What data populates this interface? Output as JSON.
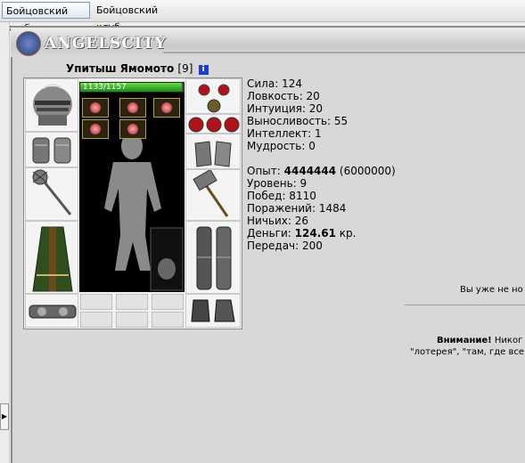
{
  "tabs": [
    {
      "label": "Бойцовский клуб",
      "active": true
    },
    {
      "label": "Бойцовский клуб",
      "active": false
    }
  ],
  "logo": {
    "text": "ANGELSCITY"
  },
  "character": {
    "name": "Упитыш Ямомото",
    "level": "[9]",
    "hp_text": "1133/1157",
    "hp_current": 1133,
    "hp_max": 1157
  },
  "stats": {
    "strength": "Сила: 124",
    "agility": "Ловкость: 20",
    "intuition": "Интуиция: 20",
    "stamina": "Выносливость: 55",
    "intellect": "Интеллект: 1",
    "wisdom": "Мудрость: 0"
  },
  "progress": {
    "exp_label": "Опыт:",
    "exp_value": "4444444",
    "exp_next": "(6000000)",
    "level": "Уровень: 9",
    "wins": "Побед: 8110",
    "losses": "Поражений: 1484",
    "draws": "Ничьих: 26",
    "money_label": "Деньги:",
    "money_value": "124.61",
    "money_unit": "кр.",
    "transfers": "Передач: 200"
  },
  "messages": {
    "line1": "Вы уже не но",
    "warning_label": "Внимание!",
    "warning_text": " Никог",
    "line3": "\"лотерея\", \"там, где все"
  },
  "icons": {
    "info": "info-icon",
    "rail_arrow": "triangle-right-icon"
  },
  "colors": {
    "hp_bar": "#2fa82f",
    "background": "#d8d8d8"
  }
}
